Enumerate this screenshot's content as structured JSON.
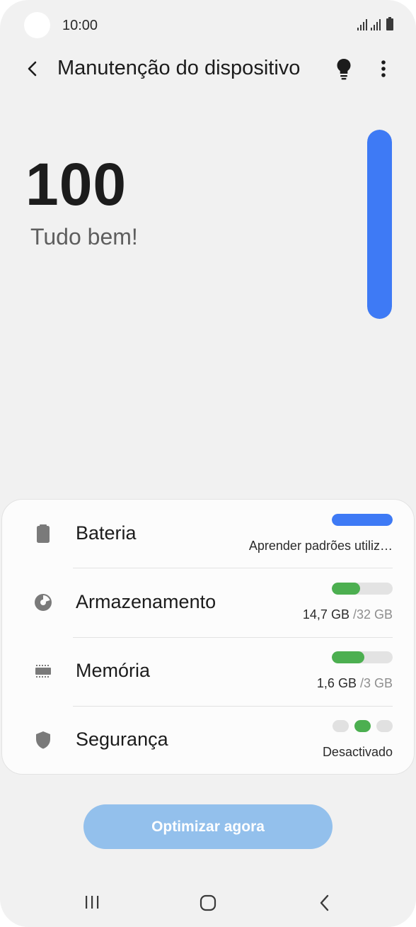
{
  "status_bar": {
    "time": "10:00"
  },
  "header": {
    "title": "Manutenção do dispositivo"
  },
  "score": {
    "value": "100",
    "status": "Tudo bem!",
    "level": 1.0
  },
  "accent_color": "#3e7af5",
  "items": [
    {
      "label": "Bateria",
      "icon": "battery-icon",
      "subtitle": "Aprender padrões utiliz…",
      "bar_fraction": 1.0,
      "bar_color": "#3e7af5"
    },
    {
      "label": "Armazenamento",
      "icon": "storage-pie-icon",
      "used": "14,7 GB",
      "total": "/32 GB",
      "bar_fraction": 0.46,
      "bar_color": "#4caf50"
    },
    {
      "label": "Memória",
      "icon": "memory-chip-icon",
      "used": "1,6 GB",
      "total": "/3 GB",
      "bar_fraction": 0.53,
      "bar_color": "#4caf50"
    },
    {
      "label": "Segurança",
      "icon": "shield-icon",
      "status": "Desactivado",
      "dots": [
        false,
        true,
        false
      ]
    }
  ],
  "actions": {
    "optimize_label": "Optimizar agora"
  }
}
